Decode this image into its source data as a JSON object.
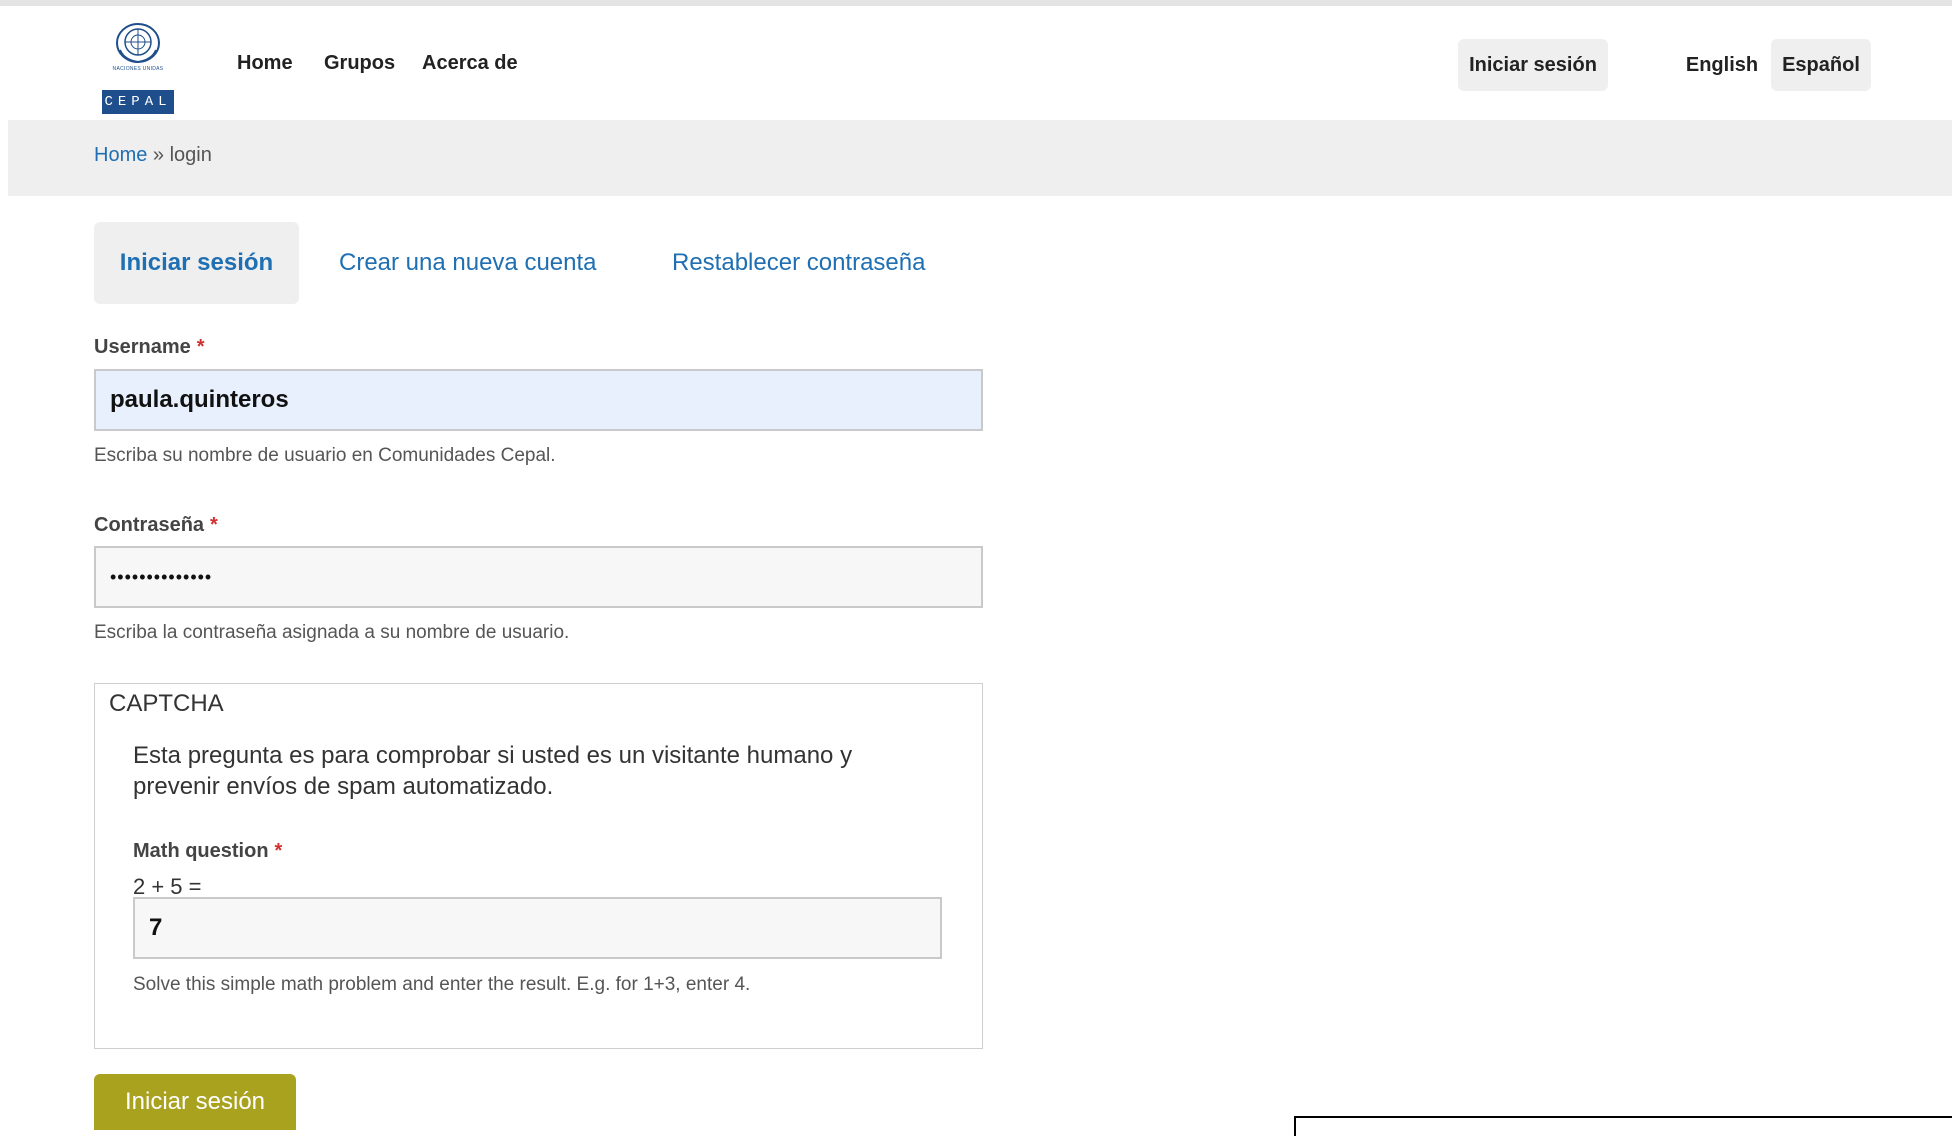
{
  "header": {
    "logo_top_text": "NACIONES UNIDAS",
    "logo_bottom_text": "CEPAL",
    "nav": [
      "Home",
      "Grupos",
      "Acerca de"
    ],
    "login_button": "Iniciar sesión",
    "languages": [
      "English",
      "Español"
    ],
    "active_language": "Español"
  },
  "breadcrumb": {
    "home": "Home",
    "separator": " » ",
    "current": "login"
  },
  "tabs": [
    "Iniciar sesión",
    "Crear una nueva cuenta",
    "Restablecer contraseña"
  ],
  "form": {
    "username_label": "Username",
    "username_value": "paula.quinteros",
    "username_help": "Escriba su nombre de usuario en Comunidades Cepal.",
    "password_label": "Contraseña",
    "password_value": "••••••••••••••",
    "password_help": "Escriba la contraseña asignada a su nombre de usuario.",
    "required_marker": "*",
    "captcha": {
      "legend": "CAPTCHA",
      "description": "Esta pregunta es para comprobar si usted es un visitante humano y prevenir envíos de spam automatizado.",
      "math_label": "Math question",
      "math_question": "2 + 5 =",
      "math_value": "7",
      "math_help": "Solve this simple math problem and enter the result. E.g. for 1+3, enter 4."
    },
    "submit_label": "Iniciar sesión"
  },
  "colors": {
    "link": "#1f6fb2",
    "submit_bg": "#a9a21f",
    "username_bg": "#e8f0fe",
    "required": "#d32f2f"
  }
}
